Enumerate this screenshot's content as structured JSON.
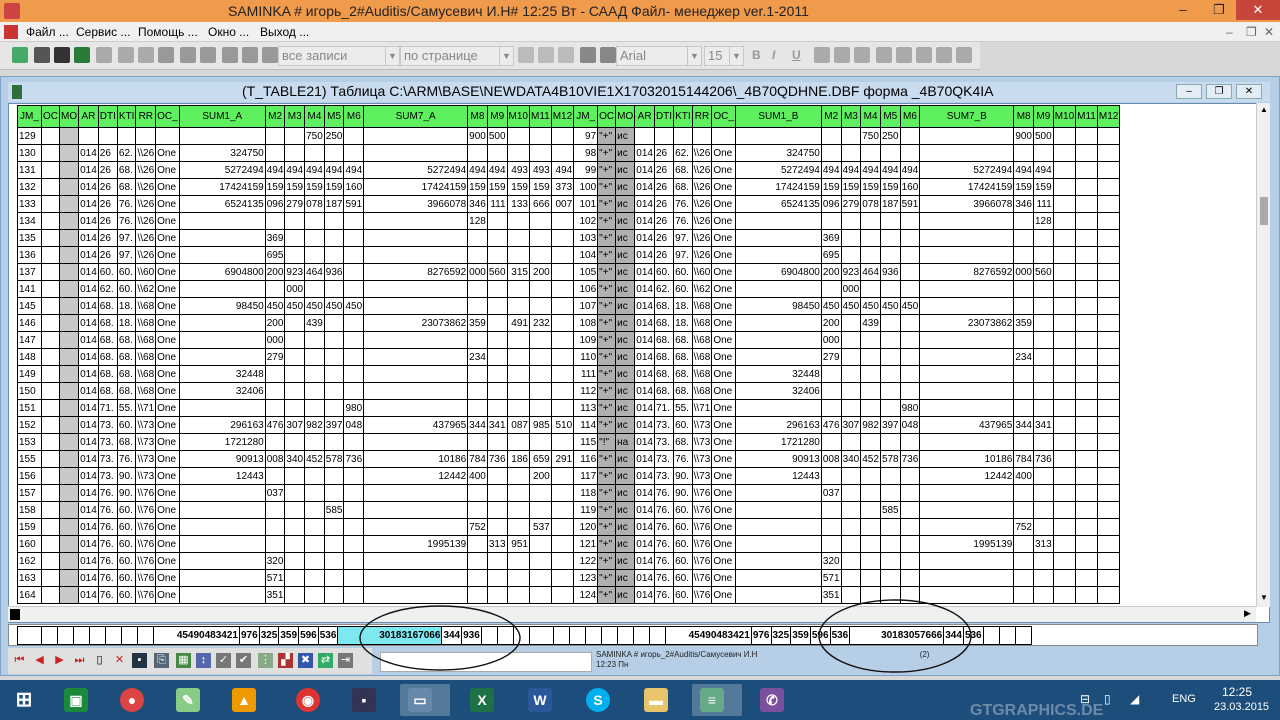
{
  "window": {
    "title": "SAMINKA # игорь_2#Auditis/Самусевич И.Н#",
    "title_time": "12:25 Вт - СААД Файл- менеджер ver.1-2011",
    "min": "–",
    "max": "❐",
    "close": "✕"
  },
  "menu": [
    "Файл ...",
    "Сервис ...",
    "Помощь ...",
    "Окно ...",
    "Выход ..."
  ],
  "toolbar": {
    "records_combo": "все записи",
    "page_combo": "по странице",
    "font_combo": "Arial",
    "size_combo": "15",
    "bold": "B",
    "italic": "I",
    "underline": "U"
  },
  "child_window": {
    "title": "(T_TABLE21)  Таблица C:\\ARM\\BASE\\NEWDATA4B10VIE1X17032015144206\\_4B70QDHNE.DBF форма _4B70QK4IA"
  },
  "grid": {
    "headers": [
      "JM_",
      "OC",
      "MO",
      "AR",
      "DTI",
      "KTI",
      "RR",
      "OC_",
      "SUM1_A",
      "M2",
      "M3",
      "M4",
      "M5",
      "M6",
      "SUM7_A",
      "M8",
      "M9",
      "M10",
      "M11",
      "M12",
      "JM_",
      "OC",
      "MO",
      "AR",
      "DTI",
      "KTI",
      "RR",
      "OC_",
      "SUM1_B",
      "M2",
      "M3",
      "M4",
      "M5",
      "M6",
      "SUM7_B",
      "M8",
      "M9",
      "M10",
      "M11",
      "M12"
    ],
    "rows": [
      [
        "129",
        "",
        "",
        "",
        "",
        "",
        "",
        "",
        "",
        "",
        "",
        "750",
        "250",
        "",
        "",
        "900",
        "500",
        "",
        "",
        "",
        "97",
        "\"+\"",
        "ис",
        "",
        "",
        "",
        "",
        "",
        "",
        "",
        "",
        "750",
        "250",
        "",
        "",
        "900",
        "500",
        "",
        "",
        ""
      ],
      [
        "130",
        "",
        "",
        "014",
        "26",
        "62.",
        "\\\\26",
        "One",
        "324750",
        "",
        "",
        "",
        "",
        "",
        "",
        "",
        "",
        "",
        "",
        "",
        "98",
        "\"+\"",
        "ис",
        "014",
        "26",
        "62.",
        "\\\\26",
        "One",
        "324750",
        "",
        "",
        "",
        "",
        "",
        "",
        "",
        "",
        "",
        "",
        ""
      ],
      [
        "131",
        "",
        "",
        "014",
        "26",
        "68.",
        "\\\\26",
        "One",
        "5272494",
        "494",
        "494",
        "494",
        "494",
        "494",
        "5272494",
        "494",
        "494",
        "493",
        "493",
        "494",
        "99",
        "\"+\"",
        "ис",
        "014",
        "26",
        "68.",
        "\\\\26",
        "One",
        "5272494",
        "494",
        "494",
        "494",
        "494",
        "494",
        "5272494",
        "494",
        "494",
        "",
        "",
        ""
      ],
      [
        "132",
        "",
        "",
        "014",
        "26",
        "68.",
        "\\\\26",
        "One",
        "17424159",
        "159",
        "159",
        "159",
        "159",
        "160",
        "17424159",
        "159",
        "159",
        "159",
        "159",
        "373",
        "100",
        "\"+\"",
        "ис",
        "014",
        "26",
        "68.",
        "\\\\26",
        "One",
        "17424159",
        "159",
        "159",
        "159",
        "159",
        "160",
        "17424159",
        "159",
        "159",
        "",
        "",
        ""
      ],
      [
        "133",
        "",
        "",
        "014",
        "26",
        "76.",
        "\\\\26",
        "One",
        "6524135",
        "096",
        "279",
        "078",
        "187",
        "591",
        "3966078",
        "346",
        "111",
        "133",
        "666",
        "007",
        "101",
        "\"+\"",
        "ис",
        "014",
        "26",
        "76.",
        "\\\\26",
        "One",
        "6524135",
        "096",
        "279",
        "078",
        "187",
        "591",
        "3966078",
        "346",
        "111",
        "",
        "",
        ""
      ],
      [
        "134",
        "",
        "",
        "014",
        "26",
        "76.",
        "\\\\26",
        "One",
        "",
        "",
        "",
        "",
        "",
        "",
        "",
        "128",
        "",
        "",
        "",
        "",
        "102",
        "\"+\"",
        "ис",
        "014",
        "26",
        "76.",
        "\\\\26",
        "One",
        "",
        "",
        "",
        "",
        "",
        "",
        "",
        "",
        "128",
        "",
        "",
        ""
      ],
      [
        "135",
        "",
        "",
        "014",
        "26",
        "97.",
        "\\\\26",
        "One",
        "",
        "369",
        "",
        "",
        "",
        "",
        "",
        "",
        "",
        "",
        "",
        "",
        "103",
        "\"+\"",
        "ис",
        "014",
        "26",
        "97.",
        "\\\\26",
        "One",
        "",
        "369",
        "",
        "",
        "",
        "",
        "",
        "",
        "",
        "",
        "",
        ""
      ],
      [
        "136",
        "",
        "",
        "014",
        "26",
        "97.",
        "\\\\26",
        "One",
        "",
        "695",
        "",
        "",
        "",
        "",
        "",
        "",
        "",
        "",
        "",
        "",
        "104",
        "\"+\"",
        "ис",
        "014",
        "26",
        "97.",
        "\\\\26",
        "One",
        "",
        "695",
        "",
        "",
        "",
        "",
        "",
        "",
        "",
        "",
        "",
        ""
      ],
      [
        "137",
        "",
        "",
        "014",
        "60.",
        "60.",
        "\\\\60",
        "One",
        "6904800",
        "200",
        "923",
        "464",
        "936",
        "",
        "8276592",
        "000",
        "560",
        "315",
        "200",
        "",
        "105",
        "\"+\"",
        "ис",
        "014",
        "60.",
        "60.",
        "\\\\60",
        "One",
        "6904800",
        "200",
        "923",
        "464",
        "936",
        "",
        "8276592",
        "000",
        "560",
        "",
        "",
        ""
      ],
      [
        "141",
        "",
        "",
        "014",
        "62.",
        "60.",
        "\\\\62",
        "One",
        "",
        "",
        "000",
        "",
        "",
        "",
        "",
        "",
        "",
        "",
        "",
        "",
        "106",
        "\"+\"",
        "ис",
        "014",
        "62.",
        "60.",
        "\\\\62",
        "One",
        "",
        "",
        "000",
        "",
        "",
        "",
        "",
        "",
        "",
        "",
        "",
        ""
      ],
      [
        "145",
        "",
        "",
        "014",
        "68.",
        "18.",
        "\\\\68",
        "One",
        "98450",
        "450",
        "450",
        "450",
        "450",
        "450",
        "",
        "",
        "",
        "",
        "",
        "",
        "107",
        "\"+\"",
        "ис",
        "014",
        "68.",
        "18.",
        "\\\\68",
        "One",
        "98450",
        "450",
        "450",
        "450",
        "450",
        "450",
        "",
        "",
        "",
        "",
        "",
        ""
      ],
      [
        "146",
        "",
        "",
        "014",
        "68.",
        "18.",
        "\\\\68",
        "One",
        "",
        "200",
        "",
        "439",
        "",
        "",
        "23073862",
        "359",
        "",
        "491",
        "232",
        "",
        "108",
        "\"+\"",
        "ис",
        "014",
        "68.",
        "18.",
        "\\\\68",
        "One",
        "",
        "200",
        "",
        "439",
        "",
        "",
        "23073862",
        "359",
        "",
        "",
        "",
        ""
      ],
      [
        "147",
        "",
        "",
        "014",
        "68.",
        "68.",
        "\\\\68",
        "One",
        "",
        "000",
        "",
        "",
        "",
        "",
        "",
        "",
        "",
        "",
        "",
        "",
        "109",
        "\"+\"",
        "ис",
        "014",
        "68.",
        "68.",
        "\\\\68",
        "One",
        "",
        "000",
        "",
        "",
        "",
        "",
        "",
        "",
        "",
        "",
        "",
        ""
      ],
      [
        "148",
        "",
        "",
        "014",
        "68.",
        "68.",
        "\\\\68",
        "One",
        "",
        "279",
        "",
        "",
        "",
        "",
        "",
        "234",
        "",
        "",
        "",
        "",
        "110",
        "\"+\"",
        "ис",
        "014",
        "68.",
        "68.",
        "\\\\68",
        "One",
        "",
        "279",
        "",
        "",
        "",
        "",
        "",
        "234",
        "",
        "",
        "",
        ""
      ],
      [
        "149",
        "",
        "",
        "014",
        "68.",
        "68.",
        "\\\\68",
        "One",
        "32448",
        "",
        "",
        "",
        "",
        "",
        "",
        "",
        "",
        "",
        "",
        "",
        "111",
        "\"+\"",
        "ис",
        "014",
        "68.",
        "68.",
        "\\\\68",
        "One",
        "32448",
        "",
        "",
        "",
        "",
        "",
        "",
        "",
        "",
        "",
        "",
        ""
      ],
      [
        "150",
        "",
        "",
        "014",
        "68.",
        "68.",
        "\\\\68",
        "One",
        "32406",
        "",
        "",
        "",
        "",
        "",
        "",
        "",
        "",
        "",
        "",
        "",
        "112",
        "\"+\"",
        "ис",
        "014",
        "68.",
        "68.",
        "\\\\68",
        "One",
        "32406",
        "",
        "",
        "",
        "",
        "",
        "",
        "",
        "",
        "",
        "",
        ""
      ],
      [
        "151",
        "",
        "",
        "014",
        "71.",
        "55.",
        "\\\\71",
        "One",
        "",
        "",
        "",
        "",
        "",
        "980",
        "",
        "",
        "",
        "",
        "",
        "",
        "113",
        "\"+\"",
        "ис",
        "014",
        "71.",
        "55.",
        "\\\\71",
        "One",
        "",
        "",
        "",
        "",
        "",
        "980",
        "",
        "",
        "",
        "",
        "",
        ""
      ],
      [
        "152",
        "",
        "",
        "014",
        "73.",
        "60.",
        "\\\\73",
        "One",
        "296163",
        "476",
        "307",
        "982",
        "397",
        "048",
        "437965",
        "344",
        "341",
        "087",
        "985",
        "510",
        "114",
        "\"+\"",
        "ис",
        "014",
        "73.",
        "60.",
        "\\\\73",
        "One",
        "296163",
        "476",
        "307",
        "982",
        "397",
        "048",
        "437965",
        "344",
        "341",
        "",
        "",
        ""
      ],
      [
        "153",
        "",
        "",
        "014",
        "73.",
        "68.",
        "\\\\73",
        "One",
        "1721280",
        "",
        "",
        "",
        "",
        "",
        "",
        "",
        "",
        "",
        "",
        "",
        "115",
        "\"!\"",
        "на",
        "014",
        "73.",
        "68.",
        "\\\\73",
        "One",
        "1721280",
        "",
        "",
        "",
        "",
        "",
        "",
        "",
        "",
        "",
        "",
        ""
      ],
      [
        "155",
        "",
        "",
        "014",
        "73.",
        "76.",
        "\\\\73",
        "One",
        "90913",
        "008",
        "340",
        "452",
        "578",
        "736",
        "10186",
        "784",
        "736",
        "186",
        "659",
        "291",
        "116",
        "\"+\"",
        "ис",
        "014",
        "73.",
        "76.",
        "\\\\73",
        "One",
        "90913",
        "008",
        "340",
        "452",
        "578",
        "736",
        "10186",
        "784",
        "736",
        "",
        "",
        ""
      ],
      [
        "156",
        "",
        "",
        "014",
        "73.",
        "90.",
        "\\\\73",
        "One",
        "12443",
        "",
        "",
        "",
        "",
        "",
        "12442",
        "400",
        "",
        "",
        "200",
        "",
        "117",
        "\"+\"",
        "ис",
        "014",
        "73.",
        "90.",
        "\\\\73",
        "One",
        "12443",
        "",
        "",
        "",
        "",
        "",
        "12442",
        "400",
        "",
        "",
        "",
        ""
      ],
      [
        "157",
        "",
        "",
        "014",
        "76.",
        "90.",
        "\\\\76",
        "One",
        "",
        "037",
        "",
        "",
        "",
        "",
        "",
        "",
        "",
        "",
        "",
        "",
        "118",
        "\"+\"",
        "ис",
        "014",
        "76.",
        "90.",
        "\\\\76",
        "One",
        "",
        "037",
        "",
        "",
        "",
        "",
        "",
        "",
        "",
        "",
        "",
        ""
      ],
      [
        "158",
        "",
        "",
        "014",
        "76.",
        "60.",
        "\\\\76",
        "One",
        "",
        "",
        "",
        "",
        "585",
        "",
        "",
        "",
        "",
        "",
        "",
        "",
        "119",
        "\"+\"",
        "ис",
        "014",
        "76.",
        "60.",
        "\\\\76",
        "One",
        "",
        "",
        "",
        "",
        "585",
        "",
        "",
        "",
        "",
        "",
        "",
        ""
      ],
      [
        "159",
        "",
        "",
        "014",
        "76.",
        "60.",
        "\\\\76",
        "One",
        "",
        "",
        "",
        "",
        "",
        "",
        "",
        "752",
        "",
        "",
        "537",
        "",
        "120",
        "\"+\"",
        "ис",
        "014",
        "76.",
        "60.",
        "\\\\76",
        "One",
        "",
        "",
        "",
        "",
        "",
        "",
        "",
        "752",
        "",
        "",
        "",
        ""
      ],
      [
        "160",
        "",
        "",
        "014",
        "76.",
        "60.",
        "\\\\76",
        "One",
        "",
        "",
        "",
        "",
        "",
        "",
        "1995139",
        "",
        "313",
        "951",
        "",
        "",
        "121",
        "\"+\"",
        "ис",
        "014",
        "76.",
        "60.",
        "\\\\76",
        "One",
        "",
        "",
        "",
        "",
        "",
        "",
        "1995139",
        "",
        "313",
        "",
        "",
        ""
      ],
      [
        "162",
        "",
        "",
        "014",
        "76.",
        "60.",
        "\\\\76",
        "One",
        "",
        "320",
        "",
        "",
        "",
        "",
        "",
        "",
        "",
        "",
        "",
        "",
        "122",
        "\"+\"",
        "ис",
        "014",
        "76.",
        "60.",
        "\\\\76",
        "One",
        "",
        "320",
        "",
        "",
        "",
        "",
        "",
        "",
        "",
        "",
        "",
        ""
      ],
      [
        "163",
        "",
        "",
        "014",
        "76.",
        "60.",
        "\\\\76",
        "One",
        "",
        "571",
        "",
        "",
        "",
        "",
        "",
        "",
        "",
        "",
        "",
        "",
        "123",
        "\"+\"",
        "ис",
        "014",
        "76.",
        "60.",
        "\\\\76",
        "One",
        "",
        "571",
        "",
        "",
        "",
        "",
        "",
        "",
        "",
        "",
        "",
        ""
      ],
      [
        "164",
        "",
        "",
        "014",
        "76.",
        "60.",
        "\\\\76",
        "One",
        "",
        "351",
        "",
        "",
        "",
        "",
        "",
        "",
        "",
        "",
        "",
        "",
        "124",
        "\"+\"",
        "ис",
        "014",
        "76.",
        "60.",
        "\\\\76",
        "One",
        "",
        "351",
        "",
        "",
        "",
        "",
        "",
        "",
        "",
        "",
        "",
        ""
      ]
    ],
    "totals": [
      "",
      "",
      "",
      "",
      "",
      "",
      "",
      "",
      "45490483421",
      "976",
      "325",
      "359",
      "596",
      "536",
      "30183167066",
      "344",
      "936",
      "",
      "",
      "",
      "",
      "",
      "",
      "",
      "",
      "",
      "",
      "",
      "45490483421",
      "976",
      "325",
      "359",
      "596",
      "536",
      "30183057666",
      "344",
      "536",
      "",
      "",
      ""
    ]
  },
  "status": {
    "user_line": "SAMINKA # игорь_2#Auditis/Самусевич И.Н",
    "page": "(2)",
    "time": "12:23 Пн"
  },
  "taskbar": {
    "lang": "ENG",
    "time": "12:25",
    "date": "23.03.2015",
    "watermark": "GTGRAPHICS.DE"
  },
  "colors": {
    "header_green": "#5ff05f",
    "title_orange": "#f09a4c",
    "taskbar_blue": "#1d4d7a",
    "highlight_cyan": "#7ee8f0"
  }
}
